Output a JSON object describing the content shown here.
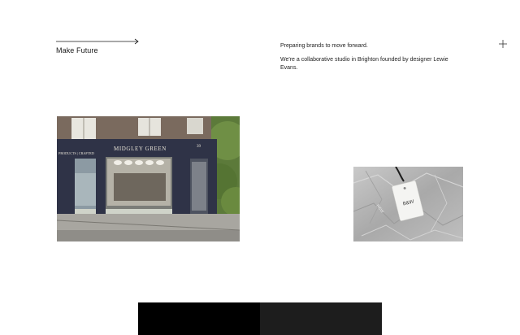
{
  "brand": {
    "tagline": "Make Future"
  },
  "intro": {
    "line1": "Preparing brands to move forward.",
    "line2": "We're a collaborative studio in Brighton founded by designer Lewie Evans."
  },
  "menu": {
    "icon": "plus-icon"
  },
  "projects": [
    {
      "name": "shop-front",
      "sign_left": "PRODUCTS | CRAFTED",
      "sign_main": "MIDGLEY GREEN",
      "door_number": "39"
    },
    {
      "name": "swing-tag",
      "tag_text": "B&W",
      "tag_side_text": "R&W"
    }
  ],
  "colors": {
    "accent": "#1a1a1a",
    "shopfront": "#2f3347",
    "background": "#ffffff"
  }
}
